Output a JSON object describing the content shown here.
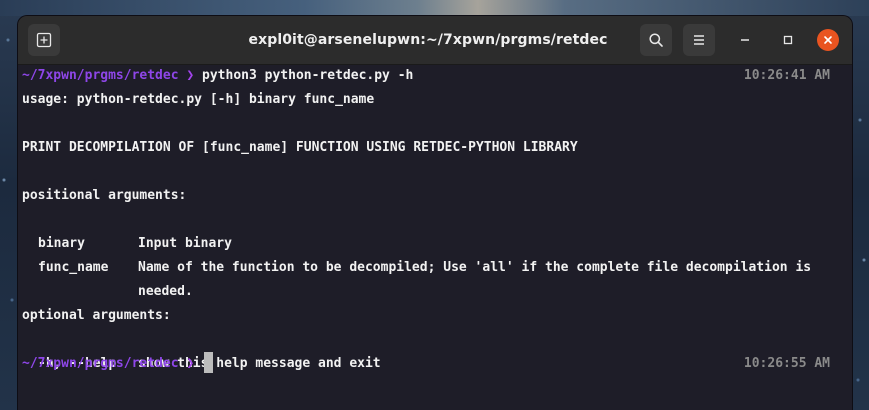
{
  "window": {
    "title": "expl0it@arsenelupwn:~/7xpwn/prgms/retdec"
  },
  "icons": {
    "new_tab": "new-tab-icon",
    "search": "search-icon",
    "menu": "hamburger-menu-icon",
    "minimize": "minimize-icon",
    "maximize": "maximize-icon",
    "close": "close-icon"
  },
  "colors": {
    "prompt_path": "#8e46e8",
    "prompt_arrow": "#a344ee",
    "close_button": "#e95420",
    "terminal_bg": "#1e1d28",
    "timestamp": "#8a8a8a"
  },
  "terminal": {
    "prompt1": {
      "path": "~/7xpwn/prgms/retdec",
      "arrow": "❯",
      "command": "python3 python-retdec.py -h",
      "time": "10:26:41 AM"
    },
    "usage": "usage: python-retdec.py [-h] binary func_name",
    "description": "PRINT DECOMPILATION OF [func_name] FUNCTION USING RETDEC-PYTHON LIBRARY",
    "positional_header": "positional arguments:",
    "positional": [
      {
        "name": "binary",
        "desc": "Input binary"
      },
      {
        "name": "func_name",
        "desc": "Name of the function to be decompiled; Use 'all' if the complete file decompilation is",
        "desc_cont": "needed."
      }
    ],
    "optional_header": "optional arguments:",
    "optional": [
      {
        "name": "-h, --help",
        "desc": "show this help message and exit"
      }
    ],
    "prompt2": {
      "path": "~/7xpwn/prgms/retdec",
      "arrow": "❯",
      "time": "10:26:55 AM"
    }
  }
}
